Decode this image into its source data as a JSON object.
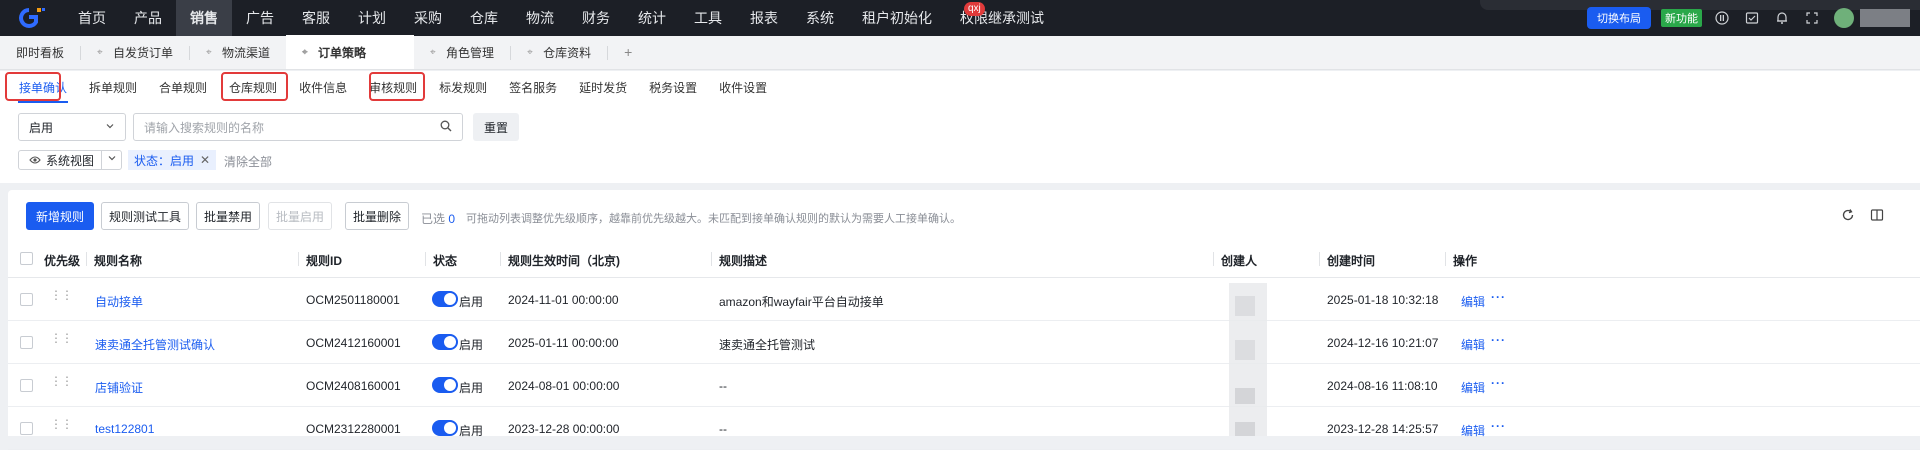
{
  "topnav": {
    "items": [
      "首页",
      "产品",
      "销售",
      "广告",
      "客服",
      "计划",
      "采购",
      "仓库",
      "物流",
      "财务",
      "统计",
      "工具",
      "报表",
      "系统",
      "租户初始化",
      "权限继承测试"
    ],
    "active_index": 2,
    "badge": "qxj",
    "switch_layout": "切换布局",
    "new_feature": "新功能"
  },
  "pagetabs": [
    "即时看板",
    "自发货订单",
    "物流渠道",
    "订单策略",
    "角色管理",
    "仓库资料"
  ],
  "pagetabs_active": "订单策略",
  "subtabs": [
    "接单确认",
    "拆单规则",
    "合单规则",
    "仓库规则",
    "收件信息",
    "审核规则",
    "标发规则",
    "签名服务",
    "延时发货",
    "税务设置",
    "收件设置"
  ],
  "filters": {
    "status_value": "启用",
    "search_placeholder": "请输入搜索规则的名称",
    "reset": "重置",
    "view": "系统视图",
    "tag": "状态：启用",
    "clear_all": "清除全部"
  },
  "toolbar": {
    "new_rule": "新增规则",
    "test_tool": "规则测试工具",
    "batch_disable": "批量禁用",
    "batch_enable": "批量启用",
    "batch_delete": "批量删除",
    "selected_prefix": "已选",
    "selected_count": "0",
    "hint": "可拖动列表调整优先级顺序，越靠前优先级越大。未匹配到接单确认规则的默认为需要人工接单确认。"
  },
  "table": {
    "headers": [
      "优先级",
      "规则名称",
      "规则ID",
      "状态",
      "规则生效时间（北京)",
      "规则描述",
      "创建人",
      "创建时间",
      "操作"
    ],
    "rows": [
      {
        "name": "自动接单",
        "id": "OCM2501180001",
        "status": "启用",
        "effective": "2024-11-01 00:00:00",
        "desc": "amazon和wayfair平台自动接单",
        "created": "2025-01-18 10:32:18",
        "edit": "编辑"
      },
      {
        "name": "速卖通全托管测试确认",
        "id": "OCM2412160001",
        "status": "启用",
        "effective": "2025-01-11 00:00:00",
        "desc": "速卖通全托管测试",
        "created": "2024-12-16 10:21:07",
        "edit": "编辑"
      },
      {
        "name": "店铺验证",
        "id": "OCM2408160001",
        "status": "启用",
        "effective": "2024-08-01 00:00:00",
        "desc": "--",
        "created": "2024-08-16 11:08:10",
        "edit": "编辑"
      },
      {
        "name": "test122801",
        "id": "OCM2312280001",
        "status": "启用",
        "effective": "2023-12-28 00:00:00",
        "desc": "--",
        "created": "2023-12-28 14:25:57",
        "edit": "编辑"
      }
    ]
  },
  "colors": {
    "primary": "#1a5cf0",
    "topbar": "#1c1f26",
    "highlight_box": "#e23a3a",
    "new_feature": "#2aa84a"
  }
}
